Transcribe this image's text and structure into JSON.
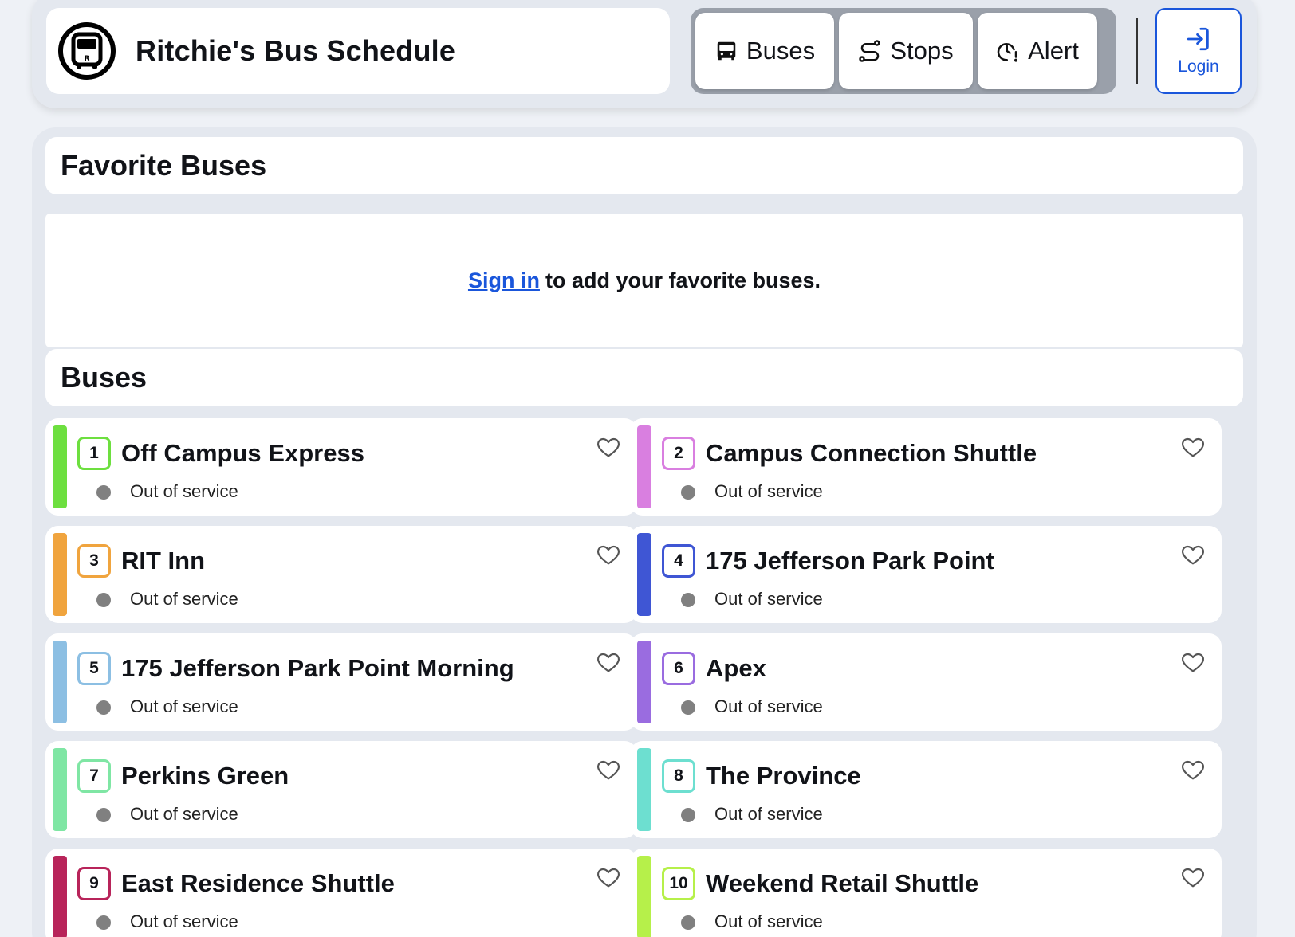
{
  "header": {
    "title": "Ritchie's Bus Schedule",
    "nav": [
      {
        "label": "Buses",
        "icon": "bus-icon"
      },
      {
        "label": "Stops",
        "icon": "route-icon"
      },
      {
        "label": "Alert",
        "icon": "clock-alert-icon"
      }
    ],
    "login_label": "Login"
  },
  "favorites": {
    "title": "Favorite Buses",
    "sign_in_link": "Sign in",
    "message": "to add your favorite buses."
  },
  "buses": {
    "title": "Buses",
    "items": [
      {
        "number": "1",
        "name": "Off Campus Express",
        "status": "Out of service",
        "color": "#6ddf3f"
      },
      {
        "number": "2",
        "name": "Campus Connection Shuttle",
        "status": "Out of service",
        "color": "#d97fe0"
      },
      {
        "number": "3",
        "name": "RIT Inn",
        "status": "Out of service",
        "color": "#f0a43e"
      },
      {
        "number": "4",
        "name": "175 Jefferson Park Point",
        "status": "Out of service",
        "color": "#3f56d4"
      },
      {
        "number": "5",
        "name": "175 Jefferson Park Point Morning",
        "status": "Out of service",
        "color": "#8cbfe3"
      },
      {
        "number": "6",
        "name": "Apex",
        "status": "Out of service",
        "color": "#9a6ce0"
      },
      {
        "number": "7",
        "name": "Perkins Green",
        "status": "Out of service",
        "color": "#7fe6a4"
      },
      {
        "number": "8",
        "name": "The Province",
        "status": "Out of service",
        "color": "#6ddfd0"
      },
      {
        "number": "9",
        "name": "East Residence Shuttle",
        "status": "Out of service",
        "color": "#b8245a"
      },
      {
        "number": "10",
        "name": "Weekend Retail Shuttle",
        "status": "Out of service",
        "color": "#b6f04a"
      }
    ]
  }
}
